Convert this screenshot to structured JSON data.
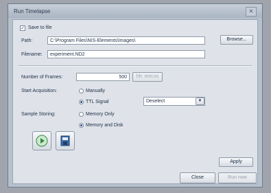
{
  "window": {
    "title": "Run Timelapse",
    "close_glyph": "✕"
  },
  "save": {
    "checkbox_label": "Save to file",
    "checked": true
  },
  "path": {
    "label": "Path:",
    "value": "C:\\Program Files\\NIS-Elements\\Images\\",
    "browse_label": "Browse..."
  },
  "filename": {
    "label": "Filename:",
    "value": "experiment.ND2"
  },
  "frames": {
    "label": "Number of Frames:",
    "value": "500",
    "unit_button": "hh: mm:ss"
  },
  "acquisition": {
    "label": "Start Acquisition:",
    "manual_label": "Manually",
    "ttl_label": "TTL Signal",
    "ttl_selected": true,
    "dropdown_value": "Deselect"
  },
  "storing": {
    "label": "Sample Storing:",
    "memory_only_label": "Memory Only",
    "memory_disk_label": "Memory and Disk",
    "memory_disk_selected": true
  },
  "icons": {
    "play": "play-icon",
    "save_stack": "save-stack-icon"
  },
  "buttons": {
    "apply": "Apply",
    "close": "Close",
    "run_now": "Run now"
  },
  "colors": {
    "window_bg": "#b7c1cd",
    "client_bg": "#dfe3e9",
    "play_green": "#2f8a3a"
  }
}
